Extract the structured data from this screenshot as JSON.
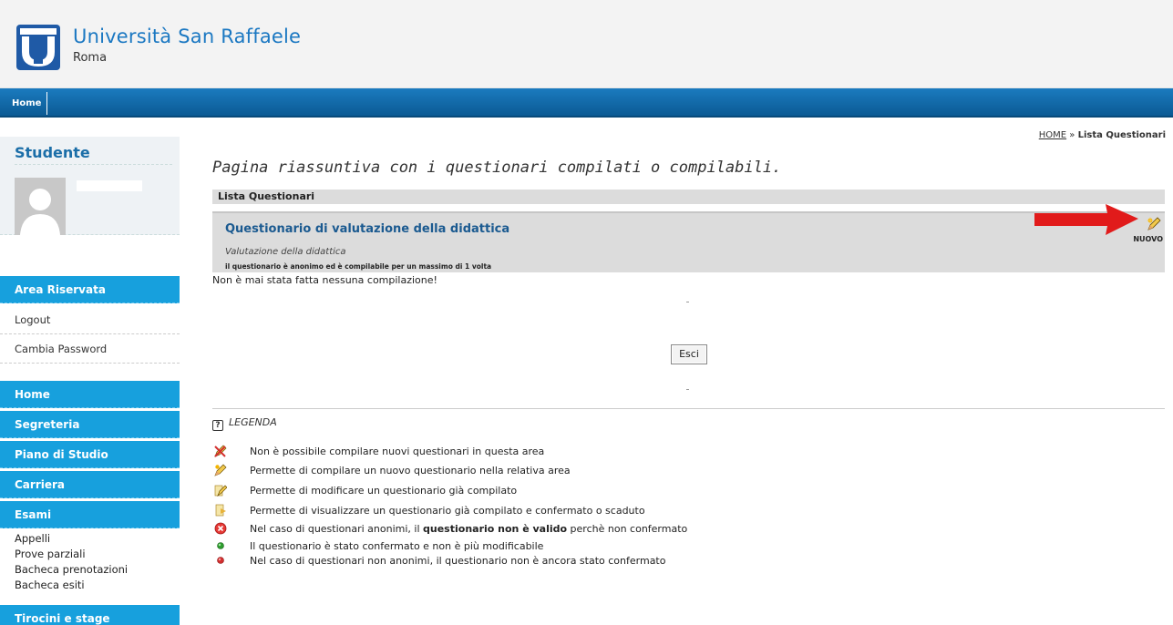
{
  "header": {
    "brand_name": "Università San Raffaele",
    "brand_city": "Roma"
  },
  "topnav": {
    "home_label": "Home"
  },
  "sidebar": {
    "student_title": "Studente",
    "area_riservata": "Area Riservata",
    "logout": "Logout",
    "cambia_password": "Cambia Password",
    "menu": [
      "Home",
      "Segreteria",
      "Piano di Studio",
      "Carriera",
      "Esami"
    ],
    "esami_items": [
      "Appelli",
      "Prove parziali",
      "Bacheca prenotazioni",
      "Bacheca esiti"
    ],
    "tirocini": "Tirocini e stage"
  },
  "breadcrumb": {
    "home": "HOME",
    "separator": " » ",
    "current": "Lista Questionari"
  },
  "main": {
    "page_title": "Pagina riassuntiva con i questionari compilati o compilabili.",
    "list_header": "Lista Questionari",
    "questionnaire": {
      "title": "Questionario di valutazione della didattica",
      "subtitle": "Valutazione della didattica",
      "note": "il questionario è anonimo ed è compilabile per un massimo di 1 volta",
      "new_label": "NUOVO"
    },
    "no_compilation": "Non è mai stata fatta nessuna compilazione!",
    "exit_button": "Esci"
  },
  "legend": {
    "title": "LEGENDA",
    "items": [
      {
        "icon": "cross-pencil-icon",
        "text": "Non è possibile compilare nuovi questionari in questa area"
      },
      {
        "icon": "new-pencil-icon",
        "text": "Permette di compilare un nuovo questionario nella relativa area"
      },
      {
        "icon": "edit-pencil-icon",
        "text": "Permette di modificare un questionario già compilato"
      },
      {
        "icon": "view-doc-icon",
        "text": "Permette di visualizzare un questionario già compilato e confermato o scaduto"
      },
      {
        "icon": "invalid-x-icon",
        "text_before": "Nel caso di questionari anonimi, il ",
        "text_bold": "questionario non è valido",
        "text_after": " perchè non confermato"
      },
      {
        "icon": "green-dot-icon",
        "text": "Il questionario è stato confermato e non è più modificabile"
      },
      {
        "icon": "red-dot-icon",
        "text": "Nel caso di questionari non anonimi, il questionario non è ancora stato confermato"
      }
    ]
  },
  "colors": {
    "accent": "#17a0dd",
    "topnav": "#0b5a94",
    "brand": "#1b78c2",
    "arrow": "#e11b1b"
  }
}
